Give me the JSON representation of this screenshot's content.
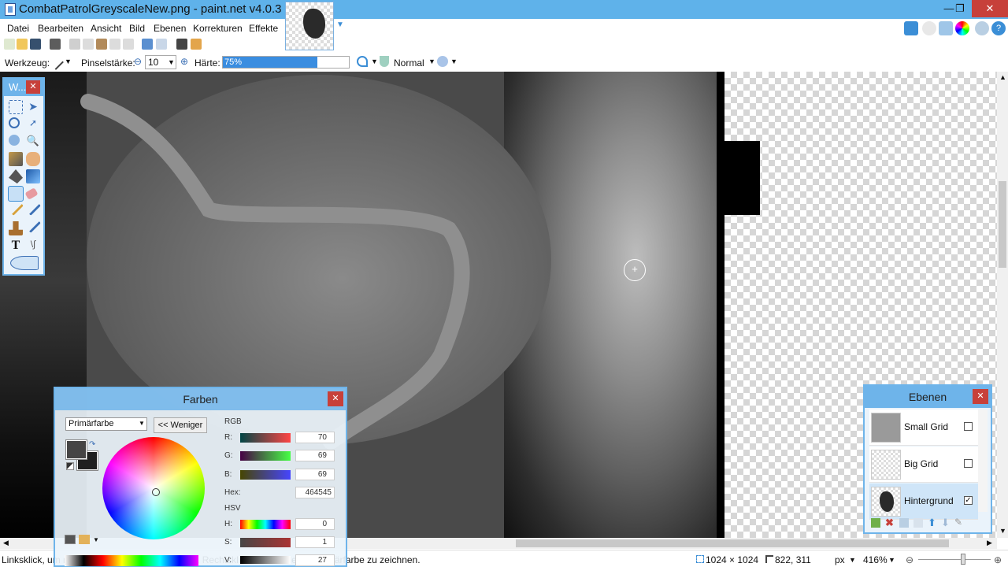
{
  "window": {
    "title": "CombatPatrolGreyscaleNew.png - paint.net v4.0.3",
    "minimize": "—",
    "maximize": "❐",
    "close": "✕"
  },
  "menu": {
    "items": [
      "Datei",
      "Bearbeiten",
      "Ansicht",
      "Bild",
      "Ebenen",
      "Korrekturen",
      "Effekte"
    ]
  },
  "toolbar": {
    "tool_label": "Werkzeug:",
    "brush_width_label": "Pinselstärke:",
    "brush_width_value": "10",
    "hardness_label": "Härte:",
    "hardness_value": "75%",
    "hardness_fraction": 0.75,
    "blend_mode": "Normal"
  },
  "tools_window": {
    "title": "W...",
    "close": "✕"
  },
  "colors_window": {
    "title": "Farben",
    "close": "✕",
    "target_select": "Primärfarbe",
    "less_button": "<< Weniger",
    "rgb_label": "RGB",
    "r_label": "R:",
    "r_value": "70",
    "g_label": "G:",
    "g_value": "69",
    "b_label": "B:",
    "b_value": "69",
    "hex_label": "Hex:",
    "hex_value": "464545",
    "hsv_label": "HSV",
    "h_label": "H:",
    "h_value": "0",
    "s_label": "S:",
    "s_value": "1",
    "v_label": "V:",
    "v_value": "27",
    "primary_color": "#464545",
    "secondary_color": "#202020"
  },
  "layers_window": {
    "title": "Ebenen",
    "close": "✕",
    "layers": [
      {
        "name": "Small Grid",
        "checked": "",
        "selected": false
      },
      {
        "name": "Big Grid",
        "checked": "",
        "selected": false
      },
      {
        "name": "Hintergrund",
        "checked": "✓",
        "selected": true
      }
    ]
  },
  "statusbar": {
    "hint": "Linksklick, um mit der Primärfarbe zu zeichnen. Rechtsklick, um mit der Sekundärfarbe zu zeichnen.",
    "image_size": "1024 × 1024",
    "cursor_pos": "822, 311",
    "unit": "px",
    "zoom": "416%"
  },
  "colors": {
    "accent": "#6eb4ea",
    "titlebar": "#5fb2ea",
    "close_red": "#c7403a"
  }
}
